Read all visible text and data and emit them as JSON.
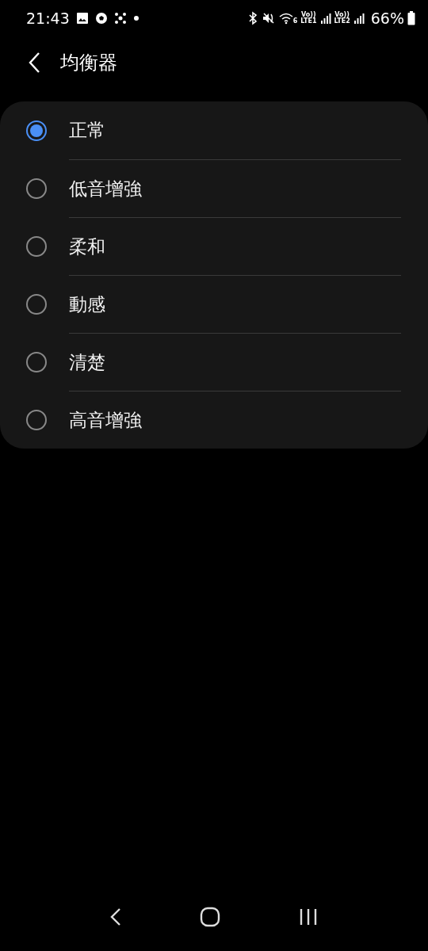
{
  "status_bar": {
    "time": "21:43",
    "wifi_badge": "6",
    "sim_labels": [
      {
        "top": "Vo))",
        "bottom": "LTE1"
      },
      {
        "top": "Vo))",
        "bottom": "LTE2"
      }
    ],
    "battery": "66%"
  },
  "header": {
    "title": "均衡器"
  },
  "options": [
    {
      "label": "正常",
      "selected": true
    },
    {
      "label": "低音增強",
      "selected": false
    },
    {
      "label": "柔和",
      "selected": false
    },
    {
      "label": "動感",
      "selected": false
    },
    {
      "label": "清楚",
      "selected": false
    },
    {
      "label": "高音增強",
      "selected": false
    }
  ]
}
